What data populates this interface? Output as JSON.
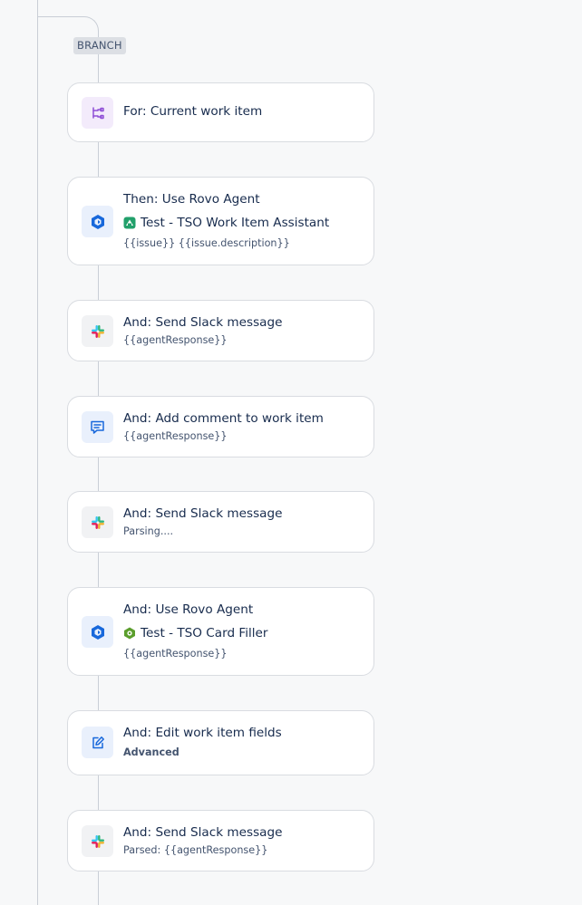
{
  "branch": {
    "label": "BRANCH"
  },
  "cards": [
    {
      "title": "For: Current work item"
    },
    {
      "title": "Then: Use Rovo Agent",
      "agent": "Test - TSO Work Item Assistant",
      "sub": "{{issue}} {{issue.description}}"
    },
    {
      "title": "And: Send Slack message",
      "sub": "{{agentResponse}}"
    },
    {
      "title": "And: Add comment to work item",
      "sub": "{{agentResponse}}"
    },
    {
      "title": "And: Send Slack message",
      "sub": "Parsing...."
    },
    {
      "title": "And: Use Rovo Agent",
      "agent": "Test - TSO Card Filler",
      "sub": "{{agentResponse}}"
    },
    {
      "title": "And: Edit work item fields",
      "sub": "Advanced"
    },
    {
      "title": "And: Send Slack message",
      "sub": "Parsed: {{agentResponse}}"
    }
  ],
  "colors": {
    "branch_icon": "#8f4fd6",
    "rovo": "#1868db",
    "comment": "#1868db",
    "edit": "#1868db",
    "agent1": "#22a06b",
    "agent2": "#5b9e2d"
  },
  "icons": {
    "branch": "branch-icon",
    "rovo": "rovo-icon",
    "slack": "slack-icon",
    "comment": "comment-icon",
    "edit": "edit-icon",
    "agent": "agent-avatar-icon"
  }
}
